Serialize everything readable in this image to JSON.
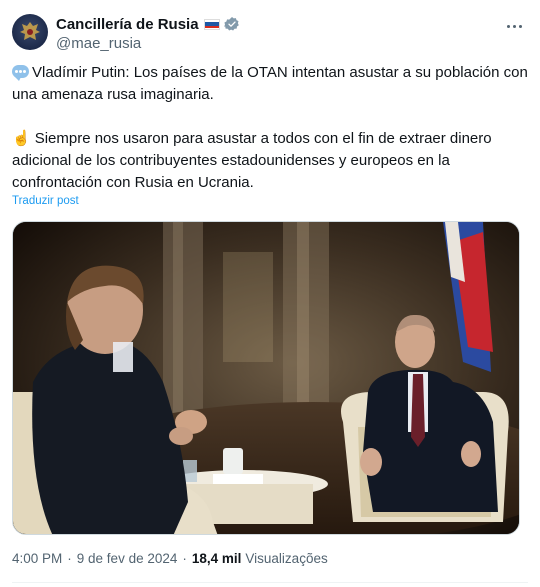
{
  "post": {
    "author": {
      "name": "Cancillería de Rusia",
      "handle": "@mae_rusia",
      "verified": true
    },
    "paragraphs": [
      {
        "emoji": "speech-balloon",
        "text": "Vladímir Putin: Los países de la OTAN intentan asustar a su población con una amenaza rusa imaginaria."
      },
      {
        "emoji": "☝️",
        "text": "Siempre nos usaron para asustar a todos con el fin de extraer dinero adicional de los contribuyentes estadounidenses y europeos en la confrontación con Rusia en Ucrania."
      }
    ],
    "translate_label": "Traduzir post",
    "time": "4:00 PM",
    "date": "9 de fev de 2024",
    "views_count": "18,4 mil",
    "views_label": "Visualizações"
  },
  "icons": {
    "verified": "verified-badge-icon",
    "more": "more-options-icon",
    "flag": "russia-flag-icon"
  },
  "colors": {
    "link": "#1d9bf0",
    "secondary_text": "#536471",
    "primary_text": "#0f1419",
    "verified": "#829aab"
  }
}
